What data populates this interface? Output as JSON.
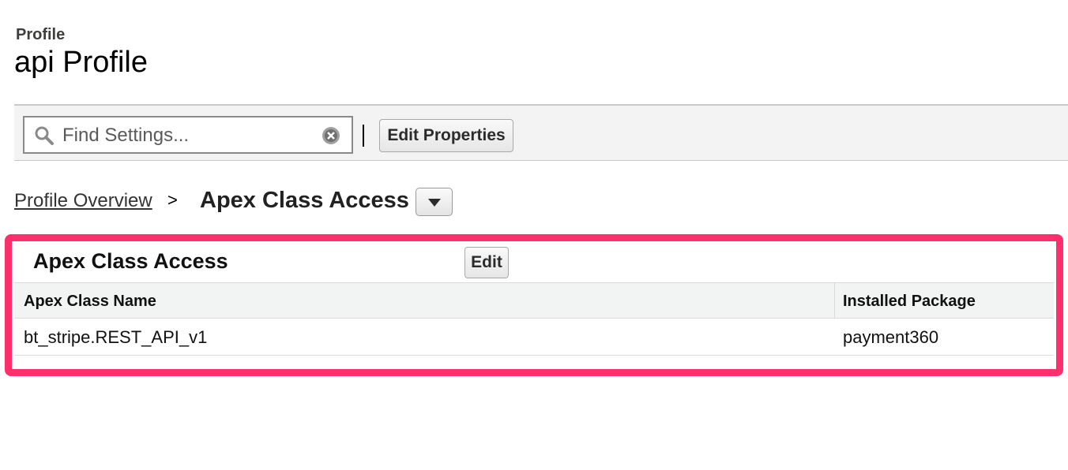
{
  "header": {
    "kicker": "Profile",
    "title": "api Profile"
  },
  "toolbar": {
    "search_placeholder": "Find Settings...",
    "search_value": "",
    "edit_properties_label": "Edit Properties"
  },
  "breadcrumb": {
    "parent_label": "Profile Overview",
    "separator": ">",
    "current_label": "Apex Class Access"
  },
  "section": {
    "title": "Apex Class Access",
    "edit_label": "Edit",
    "columns": [
      "Apex Class Name",
      "Installed Package"
    ],
    "rows": [
      {
        "apex_class_name": "bt_stripe.REST_API_v1",
        "installed_package": "payment360"
      }
    ]
  },
  "colors": {
    "highlight": "#ff2f6e",
    "toolbar_bg": "#f3f3f3",
    "table_header_bg": "#f2f3f3"
  },
  "icons": [
    "search-icon",
    "clear-icon",
    "chevron-down-icon"
  ]
}
